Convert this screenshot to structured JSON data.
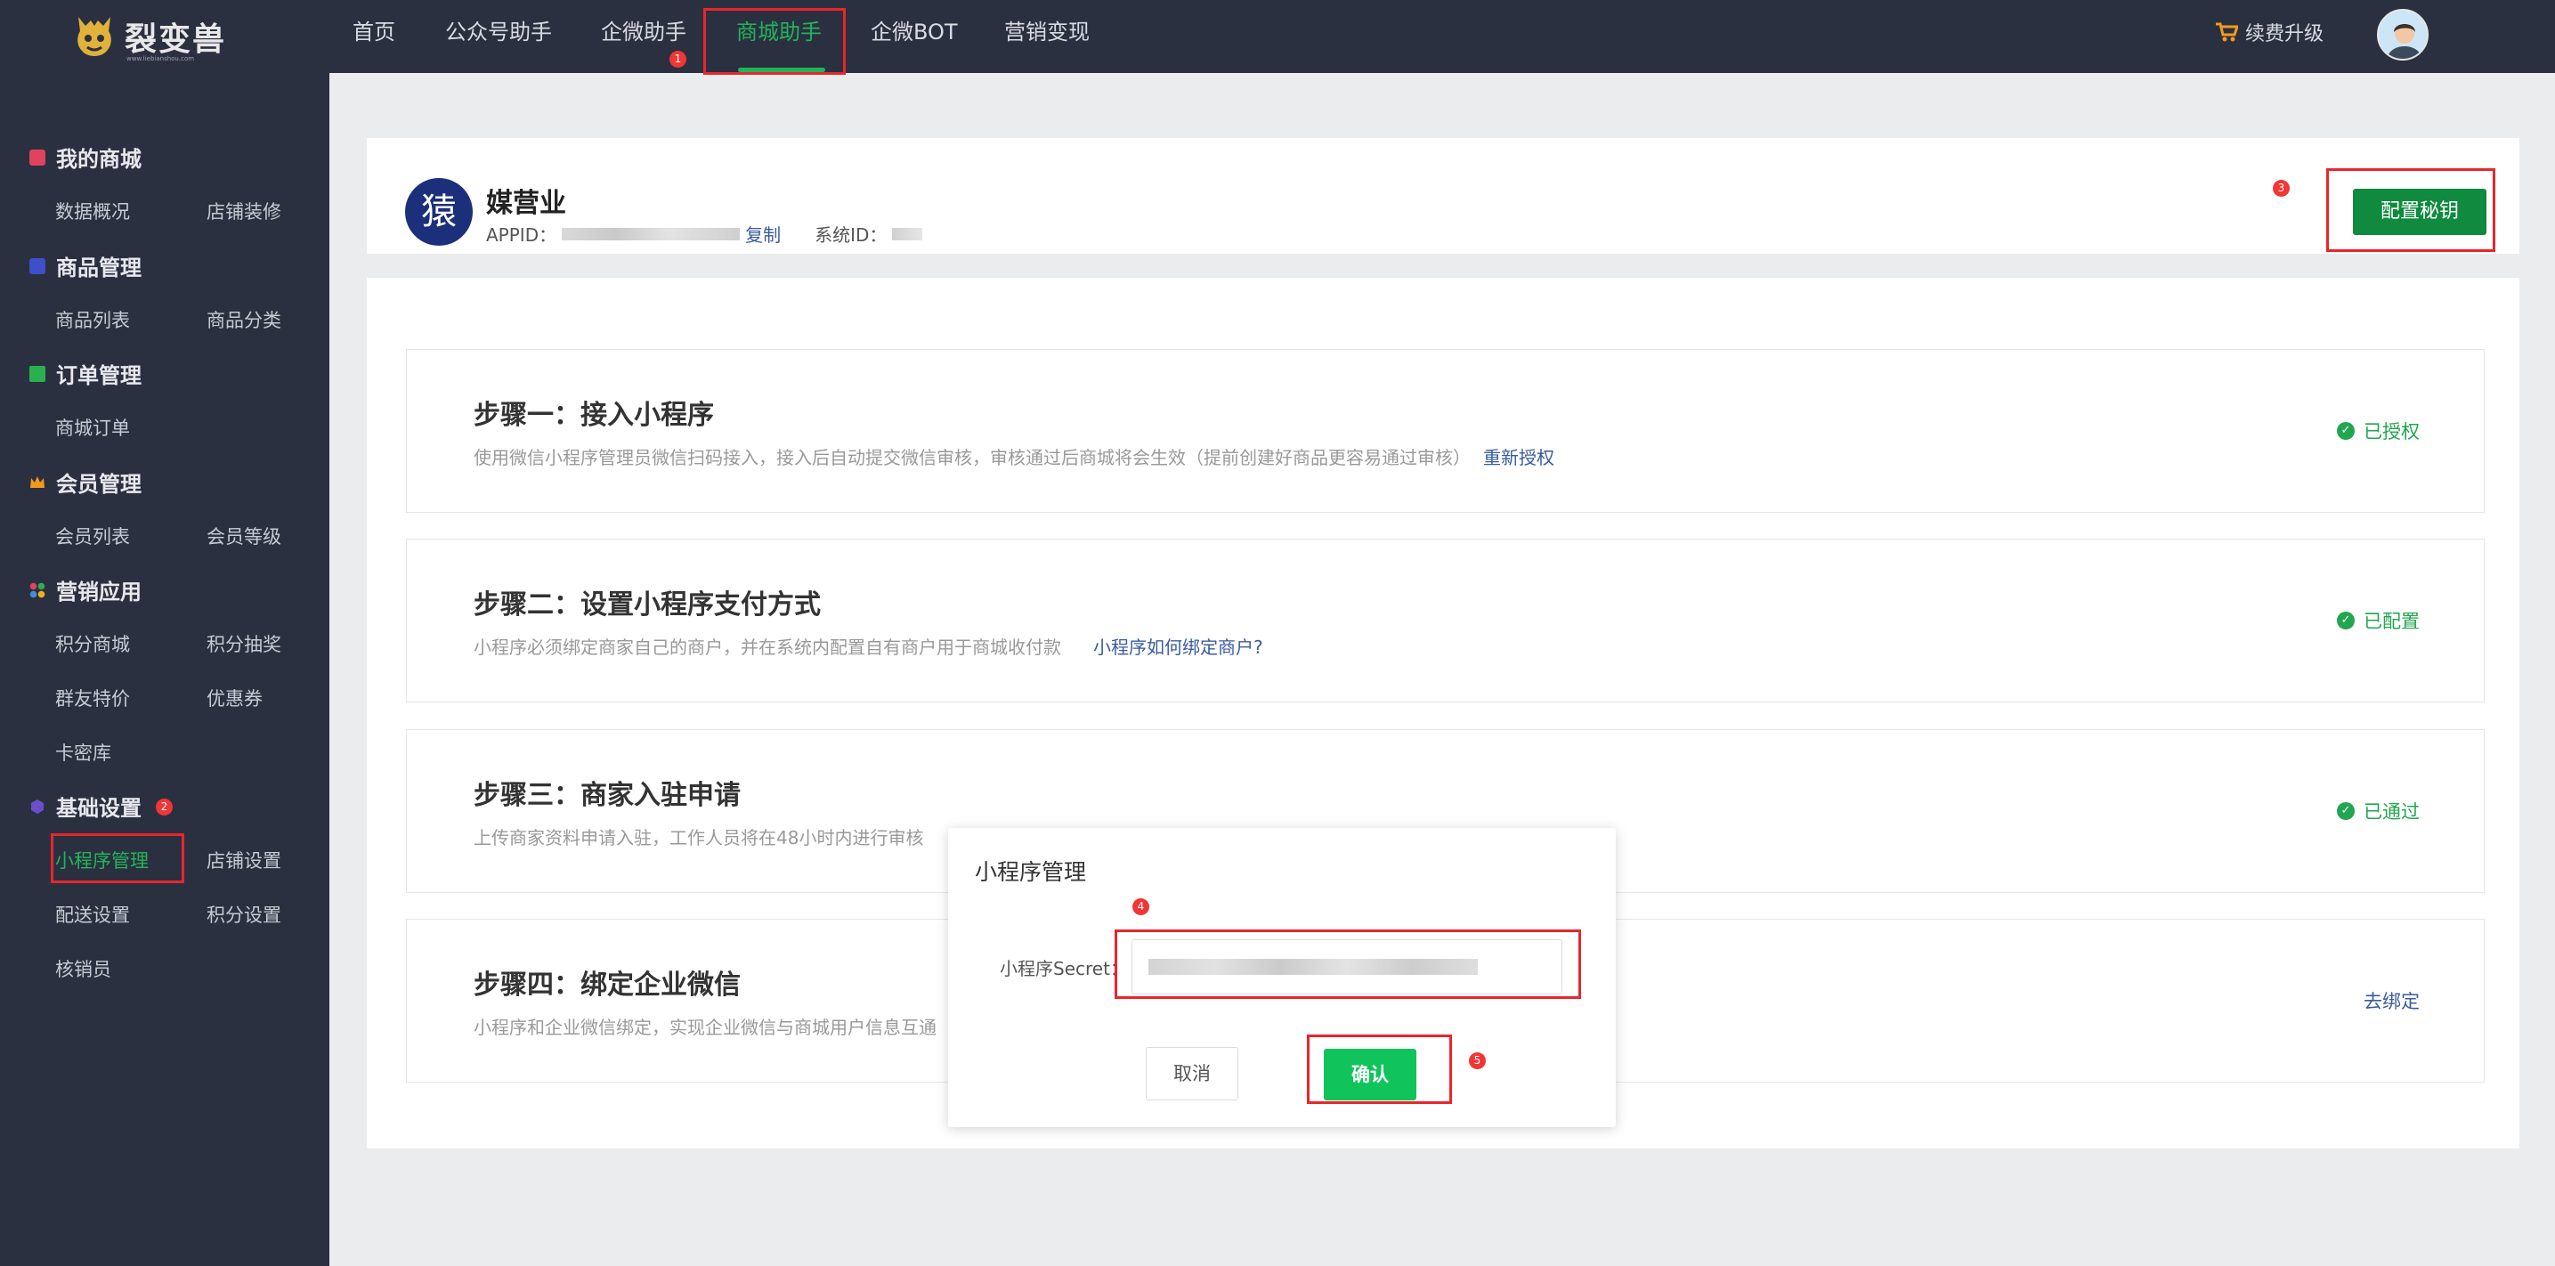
{
  "brand": {
    "name": "裂变兽",
    "sub": "www.liebianshou.com"
  },
  "nav": {
    "items": [
      "首页",
      "公众号助手",
      "企微助手",
      "商城助手",
      "企微BOT",
      "营销变现"
    ],
    "upgrade": "续费升级"
  },
  "sidebar": {
    "groups": [
      {
        "title": "我的商城",
        "items": [
          "数据概况",
          "店铺装修"
        ]
      },
      {
        "title": "商品管理",
        "items": [
          "商品列表",
          "商品分类"
        ]
      },
      {
        "title": "订单管理",
        "items": [
          "商城订单"
        ]
      },
      {
        "title": "会员管理",
        "items": [
          "会员列表",
          "会员等级"
        ]
      },
      {
        "title": "营销应用",
        "items": [
          "积分商城",
          "积分抽奖",
          "群友特价",
          "优惠券",
          "卡密库"
        ]
      },
      {
        "title": "基础设置",
        "items": [
          "小程序管理",
          "店铺设置",
          "配送设置",
          "积分设置",
          "核销员"
        ]
      }
    ]
  },
  "app": {
    "avatar_char": "猿",
    "name": "媒营业",
    "appid_label": "APPID：",
    "copy": "复制",
    "sysid_label": "系统ID：",
    "config_button": "配置秘钥"
  },
  "steps": [
    {
      "title": "步骤一：接入小程序",
      "desc": "使用微信小程序管理员微信扫码接入，接入后自动提交微信审核，审核通过后商城将会生效（提前创建好商品更容易通过审核）",
      "link": "重新授权",
      "status": "已授权"
    },
    {
      "title": "步骤二：设置小程序支付方式",
      "desc": "小程序必须绑定商家自己的商户，并在系统内配置自有商户用于商城收付款",
      "link": "小程序如何绑定商户?",
      "status": "已配置"
    },
    {
      "title": "步骤三：商家入驻申请",
      "desc": "上传商家资料申请入驻，工作人员将在48小时内进行审核",
      "link": "",
      "status": "已通过"
    },
    {
      "title": "步骤四：绑定企业微信",
      "desc": "小程序和企业微信绑定，实现企业微信与商城用户信息互通",
      "link": "",
      "status": "去绑定"
    }
  ],
  "modal": {
    "title": "小程序管理",
    "label": "小程序Secret：",
    "cancel": "取消",
    "confirm": "确认"
  },
  "annotations": [
    "1",
    "2",
    "3",
    "4",
    "5"
  ],
  "colors": {
    "topbar": "#2b3040",
    "accent": "#22b45a",
    "annotation": "#e8262b"
  }
}
